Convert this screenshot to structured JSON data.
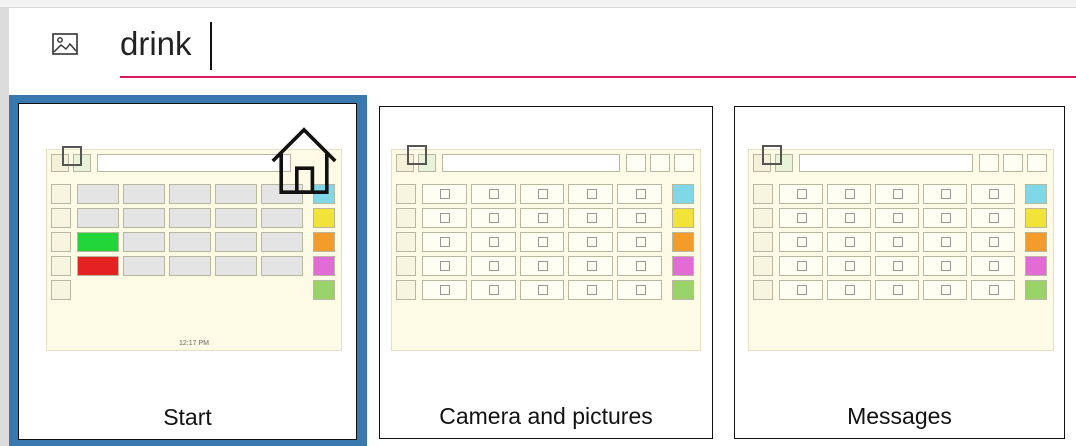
{
  "search": {
    "value": "drink",
    "placeholder": ""
  },
  "colors": {
    "accent_underline": "#d81b60",
    "selected_border": "#3a78b0",
    "board_background": "#fdfbe6"
  },
  "icons": {
    "search_leading": "image-icon",
    "home": "home-icon"
  },
  "tiles": [
    {
      "label": "Start",
      "selected": true,
      "time_text": "12:17 PM"
    },
    {
      "label": "Camera and pictures",
      "selected": false
    },
    {
      "label": "Messages",
      "selected": false
    }
  ]
}
